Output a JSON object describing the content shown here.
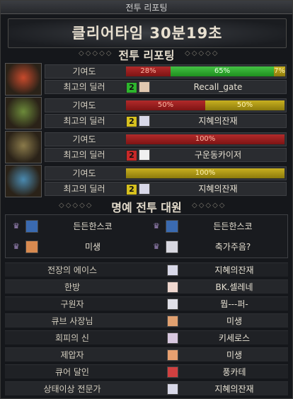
{
  "window": {
    "title": "전투 리포팅"
  },
  "banner": {
    "text": "클리어타임  30분19초"
  },
  "report": {
    "heading": "전투 리포팅",
    "contribution_label": "기여도",
    "dealer_label": "최고의 딜러",
    "rows": [
      {
        "segments": [
          {
            "label": "28%",
            "value": 0.28,
            "color": "red"
          },
          {
            "label": "65%",
            "value": 0.65,
            "color": "green"
          },
          {
            "label": "7%",
            "value": 0.07,
            "color": "yellow"
          }
        ],
        "dealer_rank": "2",
        "dealer_rank_color": "#2db52d",
        "dealer": "Recall_gate",
        "icon_color": "#c84a2c"
      },
      {
        "segments": [
          {
            "label": "50%",
            "value": 0.5,
            "color": "red"
          },
          {
            "label": "50%",
            "value": 0.5,
            "color": "yellow"
          }
        ],
        "dealer_rank": "2",
        "dealer_rank_color": "#d6c01e",
        "dealer": "지혜의잔재",
        "icon_color": "#6c8a3a"
      },
      {
        "segments": [
          {
            "label": "100%",
            "value": 1.0,
            "color": "red"
          }
        ],
        "dealer_rank": "2",
        "dealer_rank_color": "#c82828",
        "dealer": "구운동카이저",
        "icon_color": "#8a7a4a"
      },
      {
        "segments": [
          {
            "label": "100%",
            "value": 1.0,
            "color": "yellow"
          }
        ],
        "dealer_rank": "2",
        "dealer_rank_color": "#d6c01e",
        "dealer": "지혜의잔재",
        "icon_color": "#4a8ab0"
      }
    ]
  },
  "honor": {
    "heading": "명예 전투 대원",
    "members": [
      "든든한스코",
      "든든한스코",
      "미생",
      "축가주음?"
    ]
  },
  "awards": [
    {
      "title": "전장의 에이스",
      "name": "지혜의잔재"
    },
    {
      "title": "한방",
      "name": "BK.셀레네"
    },
    {
      "title": "구원자",
      "name": "뭡---퍼-"
    },
    {
      "title": "큐브 사장님",
      "name": "미생"
    },
    {
      "title": "회피의 신",
      "name": "키세로스"
    },
    {
      "title": "제압자",
      "name": "미생"
    },
    {
      "title": "큐어 달인",
      "name": "풍카테"
    },
    {
      "title": "상태이상 전문가",
      "name": "지혜의잔재"
    }
  ]
}
